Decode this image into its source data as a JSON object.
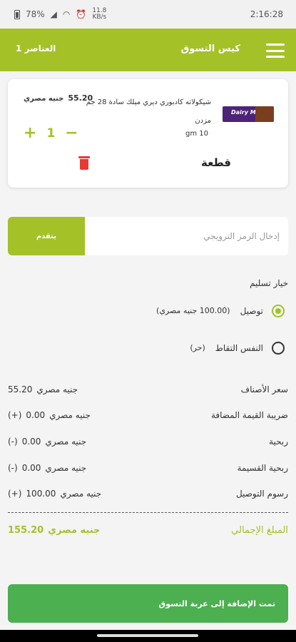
{
  "status_bar": {
    "battery": "78%",
    "time": "2:16:28",
    "data_speed_top": "11.8",
    "data_speed_bottom": "KB/s"
  },
  "app_bar": {
    "title": "كيس التسوق",
    "items_count": "1 العناصر"
  },
  "cart_item": {
    "name": "شيكولاته كادبوري ديري ميلك سادة 28 جم",
    "name_line2": "مزدن",
    "price": "55.20",
    "currency": "جنيه مصري",
    "quantity": "1",
    "weight": "10 gm",
    "unit": "قطعة",
    "image_brand": "Dairy Milk"
  },
  "promo": {
    "placeholder": "إدخال الرمز الترويجي",
    "apply_label": "يتقدم"
  },
  "delivery": {
    "title": "خيار تسليم",
    "options": [
      {
        "label": "توصيل",
        "note": "(100.00 جنيه مصري)",
        "selected": true
      },
      {
        "label": "النفس التقاط",
        "note": "(حر)",
        "selected": false
      }
    ]
  },
  "summary": [
    {
      "label": "سعر الأصناف",
      "sign": "",
      "value": "55.20",
      "currency": "جنيه مصري"
    },
    {
      "label": "ضريبة القيمة المضافة",
      "sign": "(+)",
      "value": "0.00",
      "currency": "جنيه مصري"
    },
    {
      "label": "ربحية",
      "sign": "(-)",
      "value": "0.00",
      "currency": "جنيه مصري"
    },
    {
      "label": "ربحية القسيمة",
      "sign": "(-)",
      "value": "0.00",
      "currency": "جنيه مصري"
    },
    {
      "label": "رسوم التوصيل",
      "sign": "(+)",
      "value": "100.00",
      "currency": "جنيه مصري"
    }
  ],
  "total": {
    "label": "المبلغ الإجمالي",
    "value": "155.20",
    "currency": "جنيه مصري"
  },
  "checkout": {
    "label": "تمت الإضافة إلى عربة التسوق"
  },
  "colors": {
    "accent": "#a4c128",
    "checkout": "#4caf50",
    "delete": "#e53935"
  }
}
